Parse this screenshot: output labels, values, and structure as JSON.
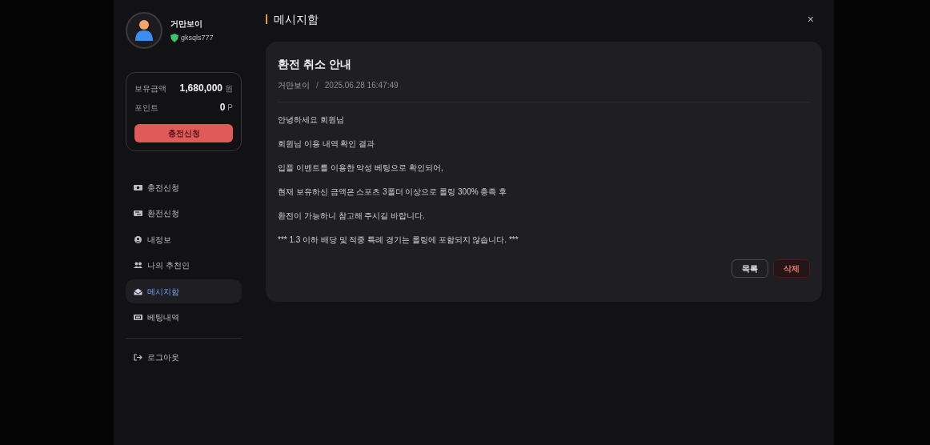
{
  "profile": {
    "name": "거만보이",
    "user_id": "gksqls777"
  },
  "wallet": {
    "rows": [
      {
        "label": "보유금액",
        "value": "1,680,000",
        "unit": "원"
      },
      {
        "label": "포인트",
        "value": "0",
        "unit": "P"
      }
    ],
    "button": "충전신청"
  },
  "menu": [
    {
      "kind": "cash",
      "label": "충전신청",
      "selected": false
    },
    {
      "kind": "exchange",
      "label": "환전신청",
      "selected": false
    },
    {
      "kind": "user",
      "label": "내정보",
      "selected": false
    },
    {
      "kind": "users",
      "label": "나의 추천인",
      "selected": false
    },
    {
      "kind": "mail",
      "label": "메시지함",
      "selected": true
    },
    {
      "kind": "list",
      "label": "베팅내역",
      "selected": false
    },
    {
      "kind": "divider"
    },
    {
      "kind": "logout",
      "label": "로그아웃",
      "selected": false
    }
  ],
  "header": {
    "title": "메시지함",
    "close": "×"
  },
  "message": {
    "title": "환전 취소 안내",
    "sender": "거만보이",
    "separator": "/",
    "date": "2025.06.28 16:47:49",
    "body": [
      "안녕하세요 회원님",
      "회원님 이용 내역 확인 결과",
      "입플 이벤트를 이용한 악성 베팅으로 확인되어,",
      "현재 보유하신 금액은 스포츠 3폴더 이상으로 롤링 300% 충족 후",
      "환전이 가능하니 참고해 주시길 바랍니다.",
      "*** 1.3 이하 배당 및 적중 특례 경기는 롤링에 포함되지 않습니다. ***"
    ],
    "buttons": [
      {
        "kind": "outline",
        "label": "목록"
      },
      {
        "kind": "danger",
        "label": "삭제"
      }
    ]
  }
}
